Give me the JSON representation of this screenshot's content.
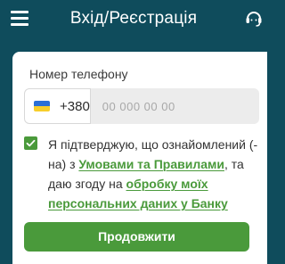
{
  "header": {
    "title": "Вхід/Реєстрація",
    "menu_icon": "hamburger-menu-icon",
    "support_icon": "support-chat-icon"
  },
  "form": {
    "phone_label": "Номер телефону",
    "country_code": "+380",
    "country_flag": "ukraine-flag-icon",
    "phone_placeholder": "00 000 00 00",
    "phone_value": "",
    "consent": {
      "checked": true,
      "text_part1": "Я підтверджую, що ознайомлений (-на) з ",
      "terms_link": "Умовами та Правилами",
      "text_part2": ", та даю згоду на ",
      "privacy_link": "обробку моїх персональних даних у Банку"
    },
    "submit_label": "Продовжити"
  },
  "colors": {
    "background": "#0f4c5c",
    "accent": "#4a9a3b",
    "input_bg": "#ececec"
  }
}
